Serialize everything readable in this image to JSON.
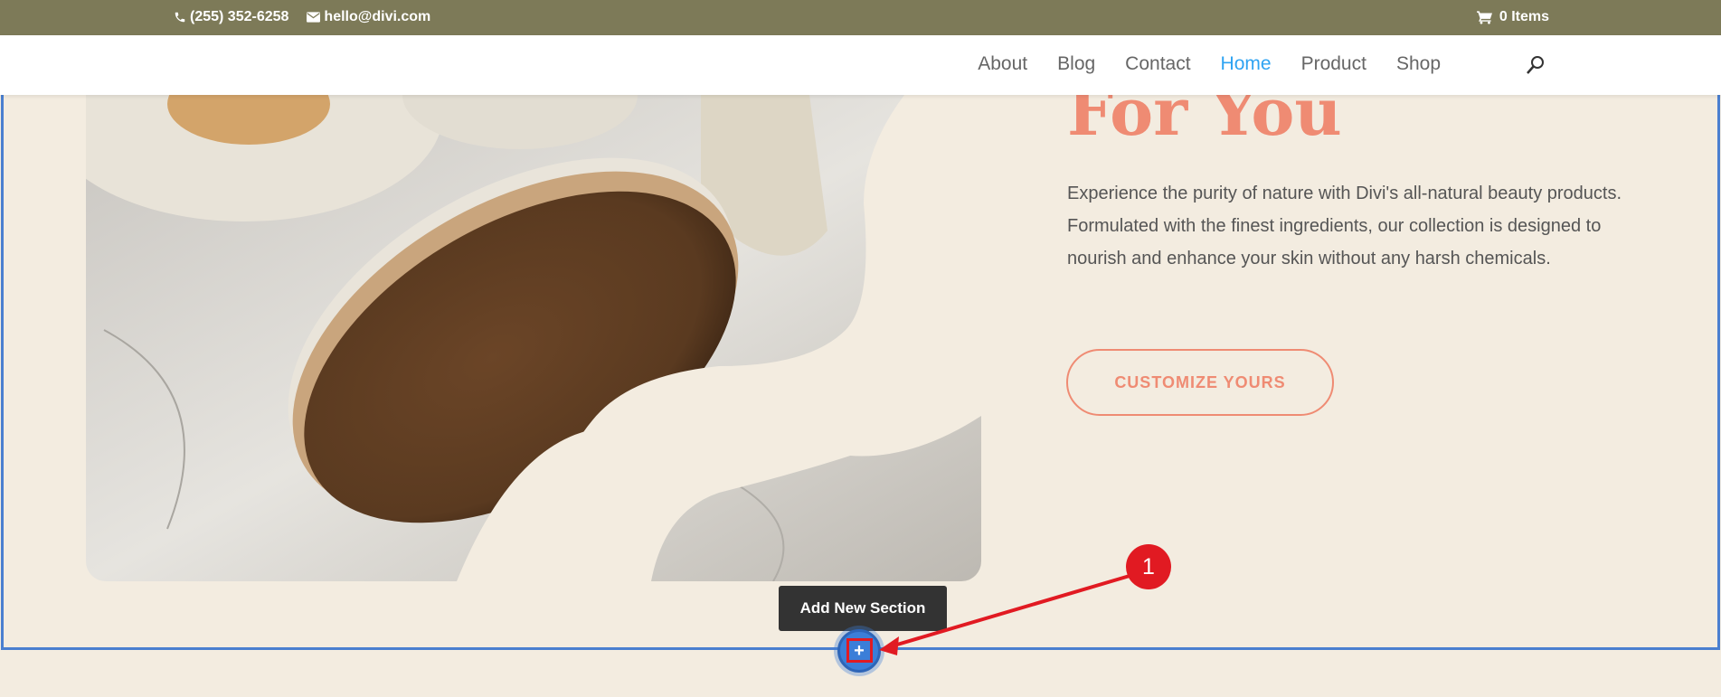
{
  "topbar": {
    "phone": "(255) 352-6258",
    "email": "hello@divi.com",
    "cart": "0 Items"
  },
  "nav": {
    "items": [
      {
        "label": "About",
        "active": false
      },
      {
        "label": "Blog",
        "active": false
      },
      {
        "label": "Contact",
        "active": false
      },
      {
        "label": "Home",
        "active": true
      },
      {
        "label": "Product",
        "active": false
      },
      {
        "label": "Shop",
        "active": false
      }
    ]
  },
  "hero": {
    "heading": "For You",
    "body": "Experience the purity of nature with Divi's all-natural beauty products. Formulated with the finest ingredients, our collection is designed to nourish and enhance your skin without any harsh chemicals.",
    "cta": "CUSTOMIZE YOURS"
  },
  "builder": {
    "tooltip": "Add New Section",
    "add_symbol": "+"
  },
  "annotation": {
    "step": "1"
  },
  "colors": {
    "topbar": "#7d7a58",
    "accent": "#ef8b73",
    "nav_active": "#2ea3f2",
    "builder_blue": "#3b7ed8",
    "annotation_red": "#e11a22"
  }
}
